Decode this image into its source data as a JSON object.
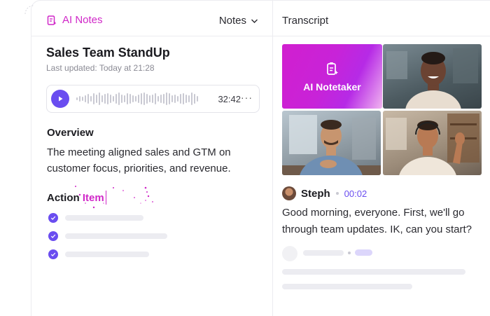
{
  "header": {
    "app_label": "AI Notes",
    "dropdown_label": "Notes",
    "transcript_label": "Transcript"
  },
  "meeting": {
    "title": "Sales Team StandUp",
    "last_updated": "Last updated: Today at 21:28"
  },
  "player": {
    "duration": "32:42",
    "more_label": "···"
  },
  "overview": {
    "heading": "Overview",
    "text": "The meeting aligned sales and GTM on customer focus, priorities, and revenue."
  },
  "action_items": {
    "heading_prefix": "Action ",
    "heading_highlight": "Item",
    "count": 3
  },
  "video": {
    "notetaker_label": "AI Notetaker"
  },
  "transcript": {
    "speaker": "Steph",
    "timestamp": "00:02",
    "text": "Good morning, everyone. First, we'll go through team updates. IK, can you start?"
  },
  "colors": {
    "accent_pink": "#d027c8",
    "accent_purple": "#6a4df0",
    "placeholder": "#ececf1"
  },
  "icons": [
    "ai-notes-icon",
    "chevron-down-icon",
    "play-icon",
    "more-icon",
    "check-icon",
    "notetaker-icon"
  ]
}
